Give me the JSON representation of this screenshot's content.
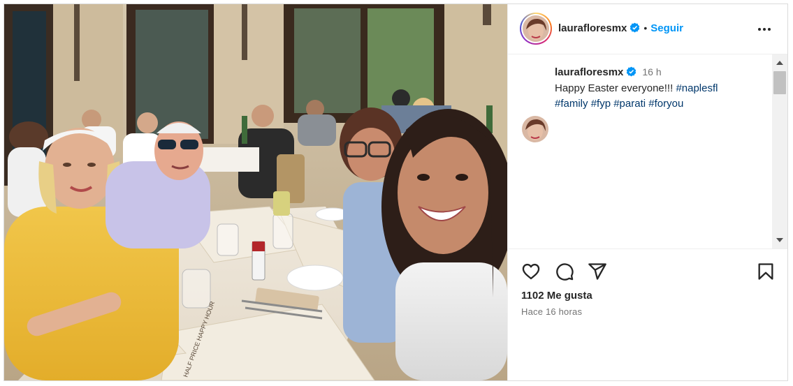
{
  "header": {
    "username": "laurafloresmx",
    "separator": "•",
    "follow_label": "Seguir"
  },
  "caption": {
    "username": "laurafloresmx",
    "time": "16 h",
    "text": "Happy Easter everyone!!! ",
    "hashtags": [
      "#naplesfl",
      "#family",
      "#fyp",
      "#parati",
      "#foryou"
    ]
  },
  "engagement": {
    "likes": "1102 Me gusta",
    "posted_ago": "Hace 16 horas"
  },
  "photo": {
    "menu_heading": "HALF PRICE HAPPY HOUR"
  },
  "colors": {
    "accent": "#0095f6",
    "hashtag": "#00376b",
    "muted": "#737373",
    "verified": "#0095f6"
  },
  "icons": [
    "more-options-icon",
    "verified-badge-icon",
    "heart-icon",
    "comment-icon",
    "share-icon",
    "bookmark-icon"
  ]
}
